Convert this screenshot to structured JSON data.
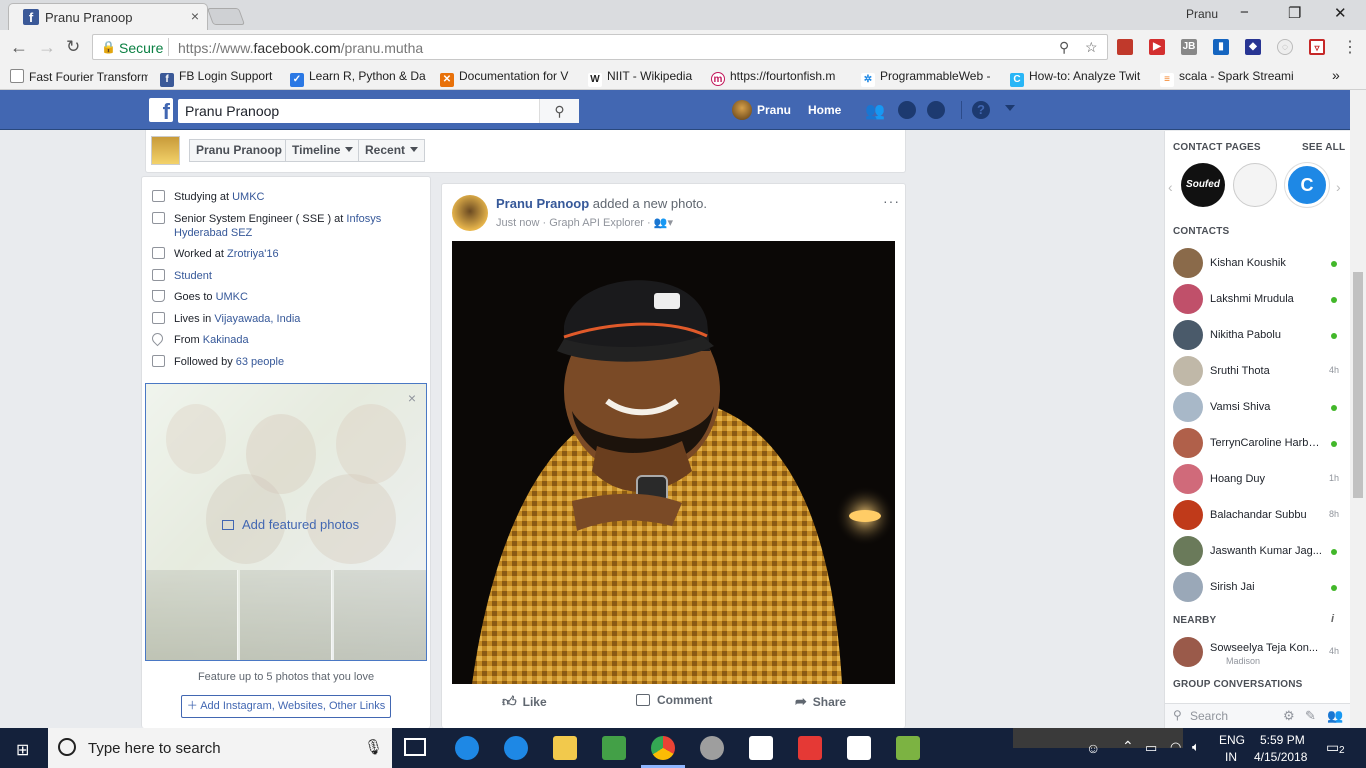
{
  "browser": {
    "tab_title": "Pranu Pranoop",
    "tab_close": "×",
    "window_user": "Pranu",
    "win_min": "−",
    "win_max": "❐",
    "win_close": "✕",
    "secure_label": "Secure",
    "url_prefix": "https://www.",
    "url_host": "facebook.com",
    "url_path": "/pranu.mutha",
    "bookmarks": [
      {
        "label": "Fast Fourier Transform",
        "icon": "page-icon",
        "color": "#888888"
      },
      {
        "label": "FB Login Support",
        "icon": "facebook-icon",
        "color": "#3b5998"
      },
      {
        "label": "Learn R, Python & Da",
        "icon": "shield-icon",
        "color": "#2b78e4"
      },
      {
        "label": "Documentation for V",
        "icon": "x-icon",
        "color": "#e8710a"
      },
      {
        "label": "NIIT - Wikipedia",
        "icon": "wikipedia-icon",
        "color": "#444444"
      },
      {
        "label": "https://fourtonfish.m",
        "icon": "m-icon",
        "color": "#c2185b"
      },
      {
        "label": "ProgrammableWeb -",
        "icon": "gear-icon",
        "color": "#1e88e5"
      },
      {
        "label": "How-to: Analyze Twit",
        "icon": "c-icon",
        "color": "#29b6f6"
      },
      {
        "label": "scala - Spark Streami",
        "icon": "stack-icon",
        "color": "#f48024"
      }
    ],
    "bookmarks_more": "»"
  },
  "fb": {
    "search_value": "Pranu Pranoop",
    "nav_name": "Pranu",
    "nav_home": "Home"
  },
  "timeline": {
    "name_button": "Pranu Pranoop",
    "timeline_button": "Timeline",
    "recent_button": "Recent"
  },
  "intro": [
    {
      "prefix": "Studying at ",
      "link": "UMKC"
    },
    {
      "prefix": "Senior System Engineer ( SSE ) at ",
      "link": "Infosys Hyderabad SEZ"
    },
    {
      "prefix": "Worked at ",
      "link": "Zrotriya'16"
    },
    {
      "prefix": "",
      "link": "Student"
    },
    {
      "prefix": "Goes to ",
      "link": "UMKC"
    },
    {
      "prefix": "Lives in ",
      "link": "Vijayawada, India"
    },
    {
      "prefix": "From ",
      "link": "Kakinada"
    },
    {
      "prefix": "Followed by ",
      "link": "63 people"
    }
  ],
  "featured": {
    "add_label": "Add featured photos",
    "close": "×",
    "caption": "Feature up to 5 photos that you love",
    "add_links": "Add Instagram, Websites, Other Links"
  },
  "post": {
    "author": "Pranu Pranoop",
    "action": " added a new photo.",
    "time": "Just now",
    "app": "Graph API Explorer",
    "more": "···",
    "like": "Like",
    "comment": "Comment",
    "share": "Share"
  },
  "chat": {
    "contact_pages": "CONTACT PAGES",
    "see_all": "SEE ALL",
    "contacts_header": "CONTACTS",
    "nearby_header": "NEARBY",
    "group_header": "GROUP CONVERSATIONS",
    "search_placeholder": "Search",
    "contacts": [
      {
        "name": "Kishan Koushik",
        "status": "online",
        "time": "",
        "color": "#8a6a4a"
      },
      {
        "name": "Lakshmi Mrudula",
        "status": "online",
        "time": "",
        "color": "#c0506a"
      },
      {
        "name": "Nikitha Pabolu",
        "status": "online",
        "time": "",
        "color": "#4a5a6a"
      },
      {
        "name": "Sruthi Thota",
        "status": "idle",
        "time": "4h",
        "color": "#c0b8a8"
      },
      {
        "name": "Vamsi Shiva",
        "status": "online",
        "time": "",
        "color": "#a8b8c8"
      },
      {
        "name": "TerrynCaroline Harba...",
        "status": "online",
        "time": "",
        "color": "#b0604a"
      },
      {
        "name": "Hoang Duy",
        "status": "idle",
        "time": "1h",
        "color": "#d06a7a"
      },
      {
        "name": "Balachandar Subbu",
        "status": "idle",
        "time": "8h",
        "color": "#c03a1a"
      },
      {
        "name": "Jaswanth Kumar Jag...",
        "status": "online",
        "time": "",
        "color": "#6a7a5a"
      },
      {
        "name": "Sirish Jai",
        "status": "online",
        "time": "",
        "color": "#9aa8b8"
      }
    ],
    "nearby": {
      "name": "Sowseelya Teja Kon...",
      "sub": "Madison",
      "time": "4h"
    }
  },
  "taskbar": {
    "search_placeholder": "Type here to search",
    "lang": "ENG",
    "region": "IN",
    "time": "5:59 PM",
    "date": "4/15/2018",
    "notifications": "2"
  }
}
